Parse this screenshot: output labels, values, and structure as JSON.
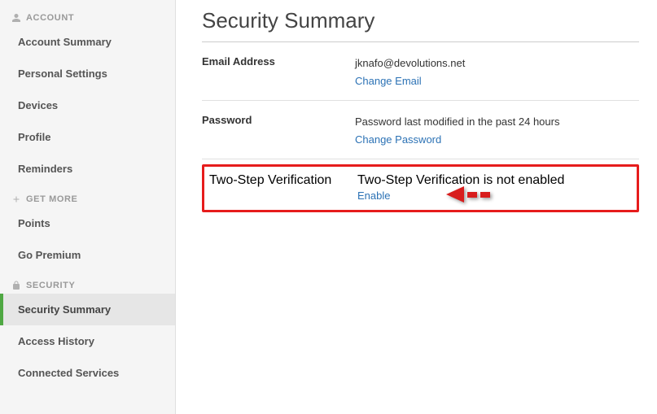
{
  "sidebar": {
    "sections": [
      {
        "title": "ACCOUNT",
        "icon": "user-icon",
        "items": [
          {
            "label": "Account Summary",
            "active": false
          },
          {
            "label": "Personal Settings",
            "active": false
          },
          {
            "label": "Devices",
            "active": false
          },
          {
            "label": "Profile",
            "active": false
          },
          {
            "label": "Reminders",
            "active": false
          }
        ]
      },
      {
        "title": "GET MORE",
        "icon": "plus-icon",
        "items": [
          {
            "label": "Points",
            "active": false
          },
          {
            "label": "Go Premium",
            "active": false
          }
        ]
      },
      {
        "title": "SECURITY",
        "icon": "lock-icon",
        "items": [
          {
            "label": "Security Summary",
            "active": true
          },
          {
            "label": "Access History",
            "active": false
          },
          {
            "label": "Connected Services",
            "active": false
          }
        ]
      }
    ]
  },
  "main": {
    "title": "Security Summary",
    "rows": [
      {
        "label": "Email Address",
        "value": "jknafo@devolutions.net",
        "link": "Change Email",
        "highlight": false
      },
      {
        "label": "Password",
        "value": "Password last modified in the past 24 hours",
        "link": "Change Password",
        "highlight": false
      },
      {
        "label": "Two-Step Verification",
        "value": "Two-Step Verification is not enabled",
        "link": "Enable",
        "highlight": true
      }
    ]
  }
}
